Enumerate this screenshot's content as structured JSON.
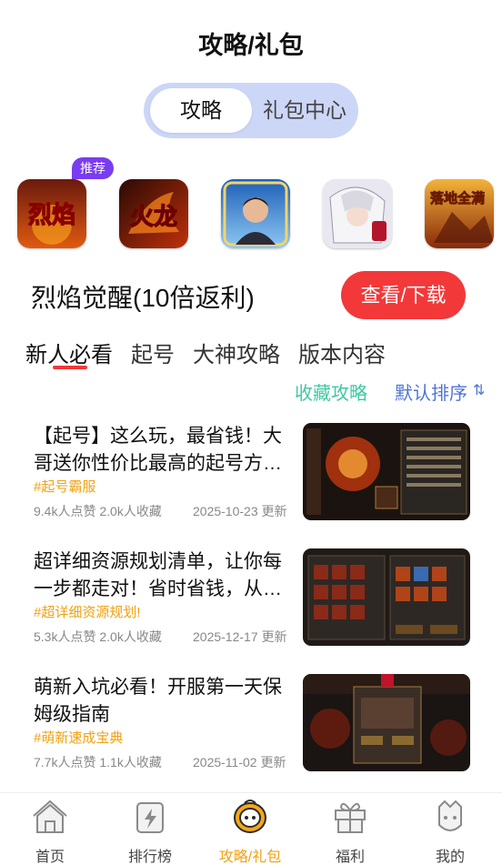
{
  "header": {
    "title": "攻略/礼包"
  },
  "segment": {
    "options": [
      "攻略",
      "礼包中心"
    ],
    "selected": "攻略"
  },
  "games": {
    "badge": "推荐",
    "items": [
      {
        "icon": "game-icon-liehuo",
        "icon_text": "烈焰"
      },
      {
        "icon": "game-icon-huolong",
        "icon_text": "火龙"
      },
      {
        "icon": "game-icon-portrait",
        "icon_text": ""
      },
      {
        "icon": "game-icon-anime",
        "icon_text": ""
      },
      {
        "icon": "game-icon-luodi",
        "icon_text": "落地全满"
      }
    ]
  },
  "selected_game": {
    "name": "烈焰觉醒(10倍返利)",
    "action": "查看/下载"
  },
  "tabs": {
    "items": [
      "新人必看",
      "起号",
      "大神攻略",
      "版本内容"
    ],
    "active": "新人必看"
  },
  "filters": {
    "favorites": "收藏攻略",
    "sort": "默认排序"
  },
  "articles": [
    {
      "title": "【起号】这么玩，最省钱！大哥送你性价比最高的起号方…",
      "tag": "#起号霸服",
      "meta": "9.4k人点赞 2.0k人收藏",
      "date": "2025-10-23 更新"
    },
    {
      "title": "超详细资源规划清单，让你每一步都走对！省时省钱，从…",
      "tag": "#超详细资源规划!",
      "meta": "5.3k人点赞 2.0k人收藏",
      "date": "2025-12-17 更新"
    },
    {
      "title": "萌新入坑必看！开服第一天保姆级指南",
      "tag": "#萌新速成宝典",
      "meta": "7.7k人点赞 1.1k人收藏",
      "date": "2025-11-02 更新"
    }
  ],
  "bottom_nav": {
    "items": [
      {
        "label": "首页",
        "icon": "home-icon"
      },
      {
        "label": "排行榜",
        "icon": "ranking-icon"
      },
      {
        "label": "攻略/礼包",
        "icon": "guide-gift-icon"
      },
      {
        "label": "福利",
        "icon": "gift-box-icon"
      },
      {
        "label": "我的",
        "icon": "profile-icon"
      }
    ],
    "active": "攻略/礼包"
  },
  "colors": {
    "accent": "#f3383a",
    "tag": "#f0a112",
    "favorite": "#3fc8a1",
    "sort": "#4f74d6",
    "badge": "#7a3cf0",
    "segment_bg": "#ccd6f7"
  }
}
